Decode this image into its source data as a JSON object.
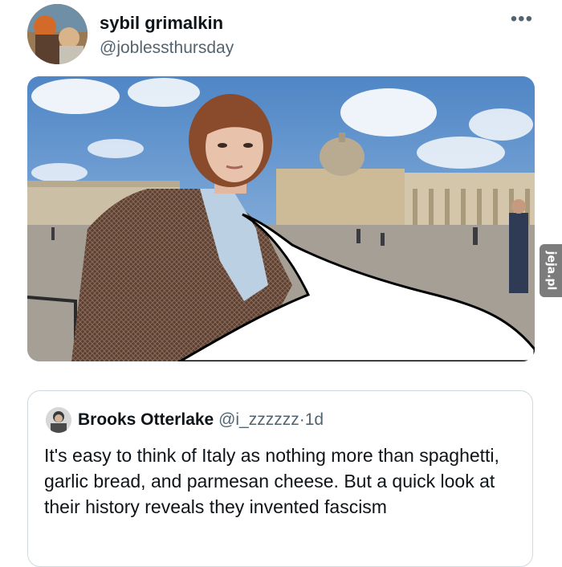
{
  "tweet": {
    "author_name": "sybil grimalkin",
    "author_handle": "@joblessthursday",
    "more_label": "•••"
  },
  "watermark": {
    "text": "jeja.pl"
  },
  "quoted_tweet": {
    "author_name": "Brooks Otterlake",
    "author_handle": "@i_zzzzzz",
    "separator": "·",
    "time": "1d",
    "text": "It's easy to think of Italy as nothing more than spaghetti, garlic bread, and parmesan cheese. But a quick look at their history reveals they invented fascism"
  },
  "colors": {
    "text_primary": "#0f1419",
    "text_secondary": "#536471",
    "border": "#cfd9de",
    "watermark_bg": "#7c7c7c"
  },
  "icons": {
    "more": "more-horizontal-icon"
  }
}
